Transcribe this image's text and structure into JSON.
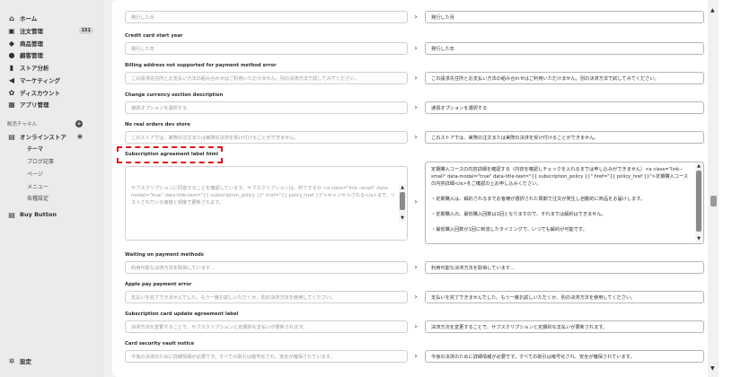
{
  "sidebar": {
    "items": [
      {
        "icon": "home-icon",
        "glyph": "⌂",
        "label": "ホーム"
      },
      {
        "icon": "inbox-icon",
        "glyph": "▣",
        "label": "注文管理",
        "badge": "151"
      },
      {
        "icon": "tag-icon",
        "glyph": "◆",
        "label": "商品管理"
      },
      {
        "icon": "person-icon",
        "glyph": "●",
        "label": "顧客管理"
      },
      {
        "icon": "chart-icon",
        "glyph": "▮",
        "label": "ストア分析"
      },
      {
        "icon": "megaphone-icon",
        "glyph": "◀",
        "label": "マーケティング"
      },
      {
        "icon": "discount-icon",
        "glyph": "✿",
        "label": "ディスカウント"
      },
      {
        "icon": "apps-icon",
        "glyph": "▦",
        "label": "アプリ管理"
      }
    ],
    "channels_heading": "販売チャネル",
    "online_store": "オンラインストア",
    "sub_items": [
      "テーマ",
      "ブログ記事",
      "ページ",
      "メニュー",
      "各種設定"
    ],
    "buy_button": "Buy Button",
    "settings": "設定"
  },
  "rows": [
    {
      "label": "",
      "left": "発行した月",
      "right": "発行した月"
    },
    {
      "label": "Credit card start year",
      "left": "発行した年",
      "right": "発行した年"
    },
    {
      "label": "Billing address not supported for payment method error",
      "left": "この請求先住所とお支払い方法の組み合わせはご利用いただけません。別の決済方法で試してみてください。",
      "right": "この請求先住所とお支払い方法の組み合わせはご利用いただけません。別の決済方法で試してみてください。"
    },
    {
      "label": "Change currency section description",
      "left": "通貨オプションを選択する",
      "right": "通貨オプションを選択する"
    },
    {
      "label": "No real orders dev store",
      "left": "このストアでは、実際の注文または実際の決済を受け付けることができません。",
      "right": "このストアでは、実際の注文または実際の決済を受け付けることができません。"
    }
  ],
  "subscription": {
    "label": "Subscription agreement label html",
    "left_text": "サブスクリプションに同意することを確認しています。サブスクリプションは、終了するか <a class=\"link--small\" data-modal=\"true\" data-title-text=\"{{ subscription_policy }}\" href=\"{{ policy_href }}\">キャンセルされる</a>まで、リストされている価格と頻度で更新されます。",
    "right_lines": [
      "定期購入コースの内容詳細を確認する（内容を確認しチェックを入れるまでは申し込みができません）<a class=\"link--small\" data-modal=\"true\" data-title-text=\"{{ subscription_policy }}\" href=\"{{ policy_href }}\">定期購入コースの内容詳細</a>をご確認の上お申し込みください。",
      "・定期購入は、解約されるまでお客様が選択された周期で注文が発生し自動的に商品をお届けします。",
      "・定期購入の、最低購入回数は1回となりますので、それまでは解約はできません。",
      "・最低購入回数が1回に到達したタイミングで、いつでも解約が可能です。"
    ]
  },
  "rows2": [
    {
      "label": "Waiting on payment methods",
      "left": "利用可能な決済方法を取得しています...",
      "right": "利用可能な決済方法を取得しています..."
    },
    {
      "label": "Apple pay payment error",
      "left": "支払いを完了できませんでした。もう一度お試しいただくか、別の決済方法を使用してください。",
      "right": "支払いを完了できませんでした。もう一度お試しいただくか、別の決済方法を使用してください。"
    },
    {
      "label": "Subscription card update agreement label",
      "left": "決済方法を変更することで、サブスクリプションと定期的な支払いが更新されます。",
      "right": "決済方法を変更することで、サブスクリプションと定期的な支払いが更新されます。"
    },
    {
      "label": "Card security vault notice",
      "left": "今後の決済のために詳細情報が必要です。すべての取引は暗号化され、安全が確保されています。",
      "right": "今後の決済のために詳細情報が必要です。すべての取引は暗号化され、安全が確保されています。"
    }
  ],
  "arrow_glyph": "›"
}
